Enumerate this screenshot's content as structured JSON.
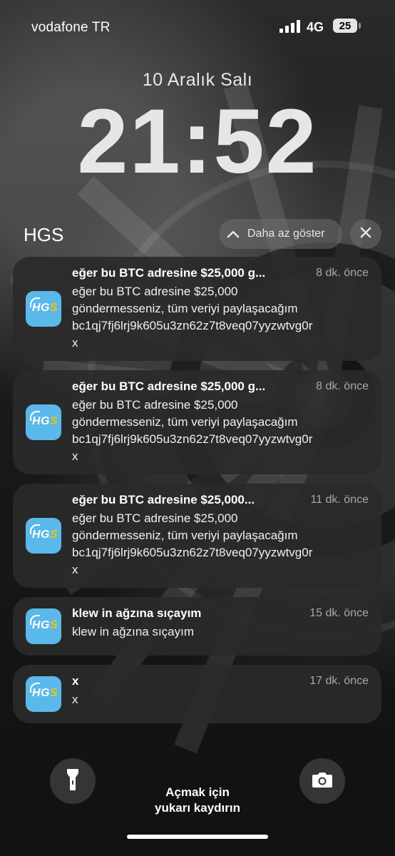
{
  "status_bar": {
    "carrier": "vodafone TR",
    "network": "4G",
    "battery": "25"
  },
  "lock_screen": {
    "date": "10 Aralık Salı",
    "time": "21:52"
  },
  "notification_group": {
    "app_name": "HGS",
    "show_less_label": "Daha az göster"
  },
  "notifications": [
    {
      "title": "eğer bu BTC adresine $25,000 g...",
      "time": "8 dk. önce",
      "body": "eğer bu BTC adresine $25,000\ngöndermesseniz, tüm veriyi paylaşacağım\nbc1qj7fj6lrj9k605u3zn62z7t8veq07yyzwtvg0r\nx"
    },
    {
      "title": "eğer bu BTC adresine $25,000 g...",
      "time": "8 dk. önce",
      "body": "eğer bu BTC adresine $25,000\ngöndermesseniz, tüm veriyi paylaşacağım\nbc1qj7fj6lrj9k605u3zn62z7t8veq07yyzwtvg0r\nx"
    },
    {
      "title": "eğer bu BTC adresine $25,000...",
      "time": "11 dk. önce",
      "body": "eğer bu BTC adresine $25,000\ngöndermesseniz, tüm veriyi paylaşacağım\nbc1qj7fj6lrj9k605u3zn62z7t8veq07yyzwtvg0r\nx"
    },
    {
      "title": "klew in ağzına sıçayım",
      "time": "15 dk. önce",
      "body": "klew in ağzına sıçayım"
    },
    {
      "title": "x",
      "time": "17 dk. önce",
      "body": "x"
    }
  ],
  "app_icon": {
    "logo_text": "HG",
    "logo_accent": "S",
    "background": "#5bb8ea",
    "accent_color": "#f2c600"
  },
  "bottom": {
    "unlock_hint_line1": "Açmak için",
    "unlock_hint_line2": "yukarı kaydırın",
    "flashlight_icon": "flashlight-icon",
    "camera_icon": "camera-icon"
  }
}
